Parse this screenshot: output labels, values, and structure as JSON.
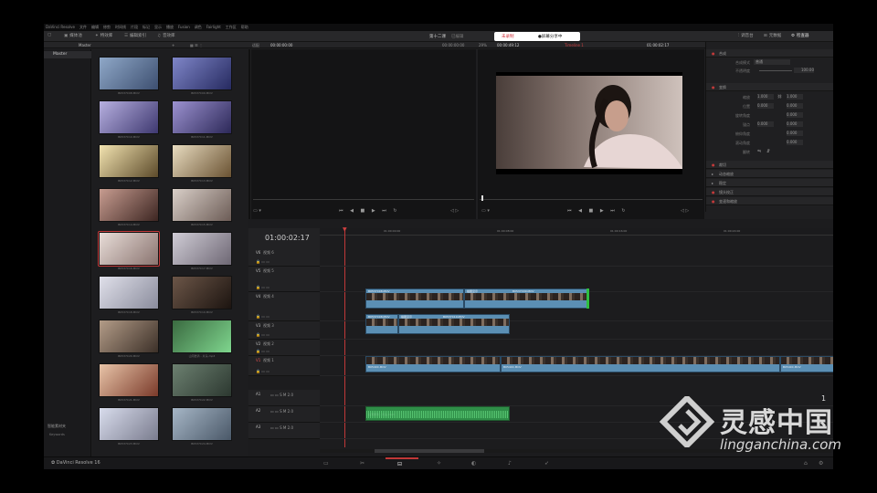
{
  "menu": [
    "DaVinci Resolve",
    "文件",
    "编辑",
    "修剪",
    "时间线",
    "片段",
    "标记",
    "显示",
    "播放",
    "Fusion",
    "调色",
    "Fairlight",
    "工作区",
    "帮助"
  ],
  "toolbar": {
    "media_pool": "媒体池",
    "effects": "特效库",
    "edit_index": "编辑索引",
    "sound_library": "音效库",
    "project_name": "第十二课",
    "project_status": "已编辑",
    "pill_left": "未录制",
    "pill_right": "●屏幕分享中",
    "mixer": "调音台",
    "metadata": "元数据",
    "inspector": "检查器"
  },
  "subbar": {
    "bin_label": "Master",
    "source_zoom": "适配",
    "source_tc": "00:00:00:00",
    "source_dur": "00:00:00:00",
    "timeline_zoom": "29%",
    "timeline_tc": "00:00:49:12",
    "timeline_name": "Timeline 1",
    "timeline_tc2": "01:00:02:17",
    "clip_name": "B0537CS8.MOV"
  },
  "bins": {
    "master": "Master",
    "smart_bins": "智能素材夹",
    "keywords": "Keywords"
  },
  "thumbs": [
    {
      "caption": "B0537C08.MOV",
      "colors": [
        "#8fa8c8",
        "#3d4f70"
      ]
    },
    {
      "caption": "B0537C09.MOV",
      "colors": [
        "#7f86c8",
        "#262a60"
      ]
    },
    {
      "caption": "B0537C10.MOV",
      "colors": [
        "#b7b0e0",
        "#3e3870"
      ]
    },
    {
      "caption": "B0537C11.MOV",
      "colors": [
        "#9c92d0",
        "#2c2858"
      ]
    },
    {
      "caption": "B0537C12.MOV",
      "colors": [
        "#f2e3b0",
        "#5c4a2a"
      ]
    },
    {
      "caption": "B0537C13.MOV",
      "colors": [
        "#e8dcc0",
        "#6a5232"
      ]
    },
    {
      "caption": "B0537C14.MOV",
      "colors": [
        "#c79c90",
        "#3d2622"
      ]
    },
    {
      "caption": "B0537C15.MOV",
      "colors": [
        "#d9cfc8",
        "#6c5c56"
      ]
    },
    {
      "caption": "B0537C16.MOV",
      "colors": [
        "#e8ddd8",
        "#8a7470"
      ]
    },
    {
      "caption": "B0537C17.MOV",
      "colors": [
        "#d0ccd6",
        "#6e6874"
      ]
    },
    {
      "caption": "B0537C18.MOV",
      "colors": [
        "#e0e0ea",
        "#8a8c9c"
      ]
    },
    {
      "caption": "B0537C19.MOV",
      "colors": [
        "#6c5648",
        "#1c1410"
      ]
    },
    {
      "caption": "B0537C20.MOV",
      "colors": [
        "#b39c88",
        "#3c3028"
      ]
    },
    {
      "caption": "山河晏清 - 片头.mp3",
      "colors": [
        "#3a6a40",
        "#7fd68e"
      ]
    },
    {
      "caption": "B0537C21.MOV",
      "colors": [
        "#e8c4a8",
        "#7a3a2a"
      ]
    },
    {
      "caption": "B0537C22.MOV",
      "colors": [
        "#6c8070",
        "#2c3830"
      ]
    },
    {
      "caption": "B0537C23.MOV",
      "colors": [
        "#d8dcec",
        "#7a7c8e"
      ]
    },
    {
      "caption": "B0537C24.MOV",
      "colors": [
        "#a6b6c6",
        "#4a5868"
      ]
    }
  ],
  "inspector": {
    "title": "B0537C08.MOV",
    "composite": "合成",
    "composite_mode": "合成模式",
    "composite_mode_val": "普通",
    "opacity": "不透明度",
    "opacity_val": "100.00",
    "transform": "变换",
    "zoom": "缩放",
    "zoom_x": "1.000",
    "zoom_y": "1.000",
    "position": "位置",
    "pos_x": "0.000",
    "pos_y": "0.000",
    "rotation": "旋转角度",
    "rotation_val": "0.000",
    "anchor": "锚点",
    "anchor_x": "0.000",
    "anchor_y": "0.000",
    "pitch": "俯仰角度",
    "pitch_val": "0.000",
    "yaw": "滚动角度",
    "yaw_val": "0.000",
    "flip": "翻转",
    "crop": "裁切",
    "dynamic_zoom": "动态缩放",
    "stabilize": "稳定",
    "lens": "镜头校正",
    "retime": "变速和缩放"
  },
  "timeline": {
    "timecode": "01:00:02:17",
    "ruler": [
      "01:00:00:00",
      "01:00:08:00",
      "01:00:16:00",
      "01:00:24:00"
    ],
    "tracks": [
      {
        "id": "V6",
        "name": "视频 6"
      },
      {
        "id": "V5",
        "name": "视频 5"
      },
      {
        "id": "V4",
        "name": "视频 4"
      },
      {
        "id": "V3",
        "name": "视频 3"
      },
      {
        "id": "V2",
        "name": "视频 2"
      },
      {
        "id": "V1",
        "name": "视频 1"
      },
      {
        "id": "A1",
        "name": ""
      },
      {
        "id": "A2",
        "name": ""
      },
      {
        "id": "A3",
        "name": ""
      }
    ],
    "v5_clips": [
      "B0537C08.MOV",
      "插图显示",
      "B0537C09.MOV"
    ],
    "v4_clips": [
      "B0537C08.MOV",
      "插图显示",
      "B0537C10.MOV"
    ],
    "v2_clips": [
      "B0540C.MOV",
      "B0540C.MOV",
      "B0540C.MOV"
    ],
    "a2_clip": "山河晏清 - 片头.mp3",
    "page_count": "1"
  },
  "pages": [
    "media-icon",
    "cut-icon",
    "edit-icon",
    "fusion-icon",
    "color-icon",
    "fairlight-icon",
    "deliver-icon"
  ],
  "brand": "DaVinci Resolve 16",
  "watermark": {
    "name": "灵感中国",
    "url": "lingganchina.com"
  }
}
